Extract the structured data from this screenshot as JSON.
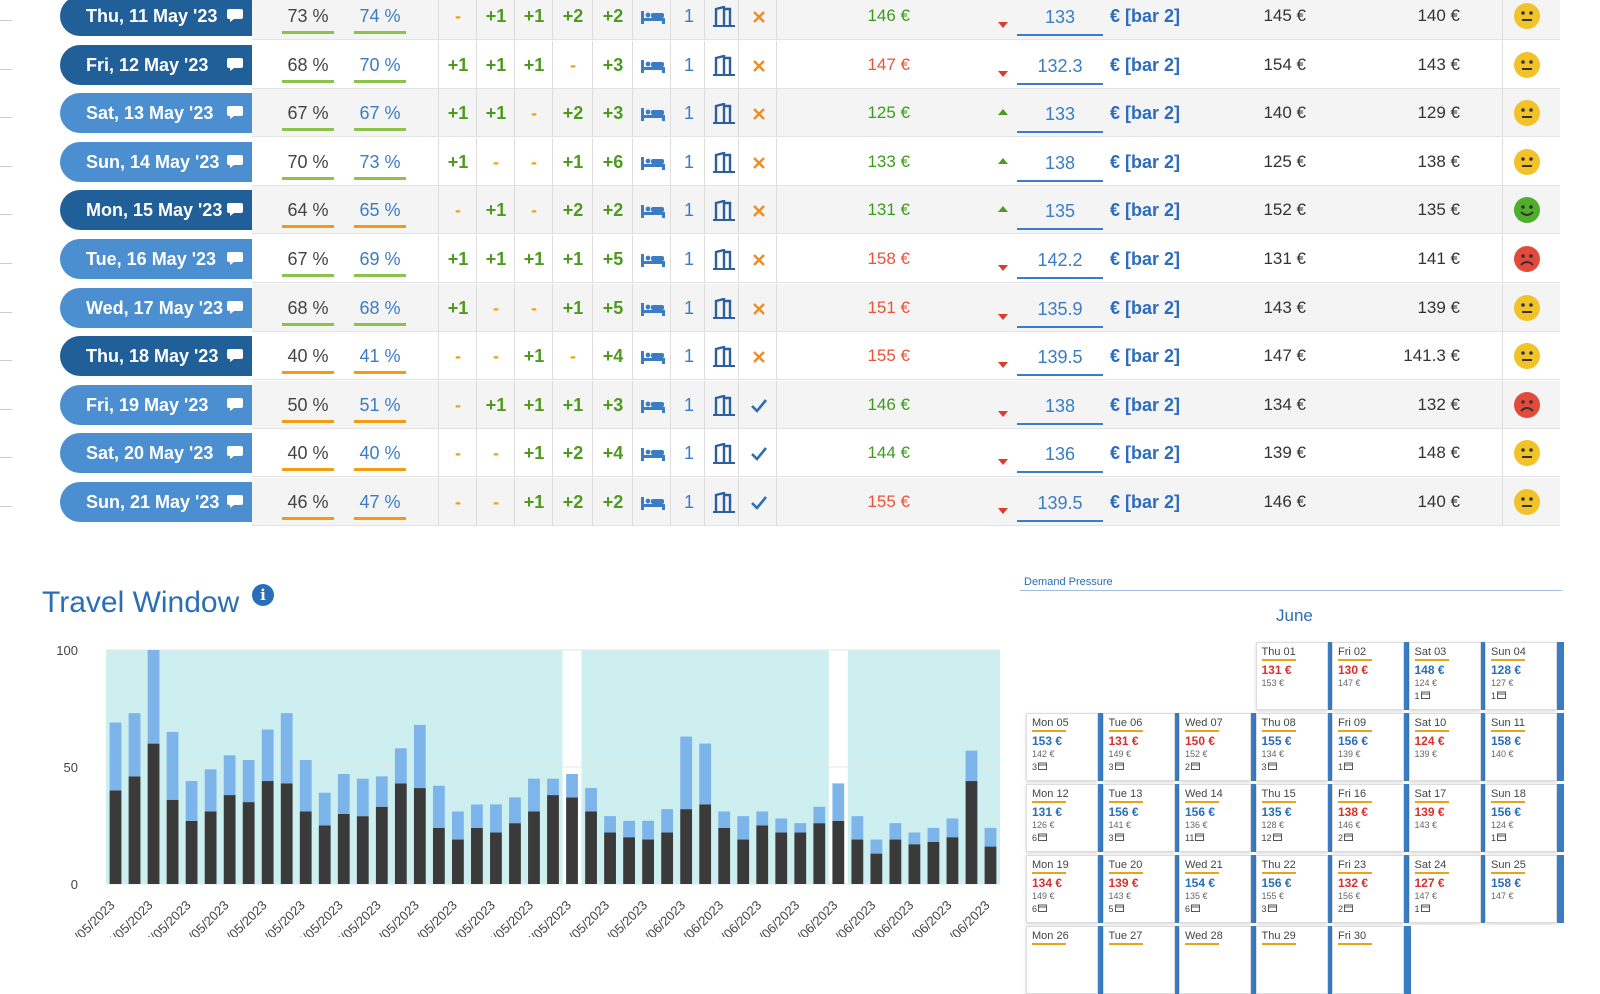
{
  "table": {
    "bar_label": "€ [bar 2]",
    "rows": [
      {
        "date": "Thu, 11 May '23",
        "style": "dark",
        "occ1": "73 %",
        "occ2": "74 %",
        "u1": "#8bc34a",
        "u2": "#8bc34a",
        "p1": "-",
        "p2": "+1",
        "p3": "+1",
        "p4": "+2",
        "p5": "+2",
        "count": "1",
        "status": "x",
        "price": "146 €",
        "price_color": "g",
        "trend": "down",
        "input": "133",
        "c1": "145 €",
        "c2": "140 €",
        "mood": "neutral"
      },
      {
        "date": "Fri, 12 May '23",
        "style": "dark",
        "occ1": "68 %",
        "occ2": "70 %",
        "u1": "#8bc34a",
        "u2": "#8bc34a",
        "p1": "+1",
        "p2": "+1",
        "p3": "+1",
        "p4": "-",
        "p5": "+3",
        "count": "1",
        "status": "x",
        "price": "147 €",
        "price_color": "r",
        "trend": "down",
        "input": "132.3",
        "c1": "154 €",
        "c2": "143 €",
        "mood": "neutral"
      },
      {
        "date": "Sat, 13 May '23",
        "style": "light",
        "occ1": "67 %",
        "occ2": "67 %",
        "u1": "#8bc34a",
        "u2": "#8bc34a",
        "p1": "+1",
        "p2": "+1",
        "p3": "-",
        "p4": "+2",
        "p5": "+3",
        "count": "1",
        "status": "x",
        "price": "125 €",
        "price_color": "g",
        "trend": "up",
        "input": "133",
        "c1": "140 €",
        "c2": "129 €",
        "mood": "neutral"
      },
      {
        "date": "Sun, 14 May '23",
        "style": "light",
        "occ1": "70 %",
        "occ2": "73 %",
        "u1": "#8bc34a",
        "u2": "#8bc34a",
        "p1": "+1",
        "p2": "-",
        "p3": "-",
        "p4": "+1",
        "p5": "+6",
        "count": "1",
        "status": "x",
        "price": "133 €",
        "price_color": "g",
        "trend": "up",
        "input": "138",
        "c1": "125 €",
        "c2": "138 €",
        "mood": "neutral"
      },
      {
        "date": "Mon, 15 May '23",
        "style": "dark",
        "occ1": "64 %",
        "occ2": "65 %",
        "u1": "#f39c12",
        "u2": "#f39c12",
        "p1": "-",
        "p2": "+1",
        "p3": "-",
        "p4": "+2",
        "p5": "+2",
        "count": "1",
        "status": "x",
        "price": "131 €",
        "price_color": "g",
        "trend": "up",
        "input": "135",
        "c1": "152 €",
        "c2": "135 €",
        "mood": "happy"
      },
      {
        "date": "Tue, 16 May '23",
        "style": "light",
        "occ1": "67 %",
        "occ2": "69 %",
        "u1": "#8bc34a",
        "u2": "#8bc34a",
        "p1": "+1",
        "p2": "+1",
        "p3": "+1",
        "p4": "+1",
        "p5": "+5",
        "count": "1",
        "status": "x",
        "price": "158 €",
        "price_color": "r",
        "trend": "down",
        "input": "142.2",
        "c1": "131 €",
        "c2": "141 €",
        "mood": "sad"
      },
      {
        "date": "Wed, 17 May '23",
        "style": "light",
        "occ1": "68 %",
        "occ2": "68 %",
        "u1": "#8bc34a",
        "u2": "#8bc34a",
        "p1": "+1",
        "p2": "-",
        "p3": "-",
        "p4": "+1",
        "p5": "+5",
        "count": "1",
        "status": "x",
        "price": "151 €",
        "price_color": "r",
        "trend": "down",
        "input": "135.9",
        "c1": "143 €",
        "c2": "139 €",
        "mood": "neutral"
      },
      {
        "date": "Thu, 18 May '23",
        "style": "dark",
        "occ1": "40 %",
        "occ2": "41 %",
        "u1": "#f39c12",
        "u2": "#f39c12",
        "p1": "-",
        "p2": "-",
        "p3": "+1",
        "p4": "-",
        "p5": "+4",
        "count": "1",
        "status": "x",
        "price": "155 €",
        "price_color": "r",
        "trend": "down",
        "input": "139.5",
        "c1": "147 €",
        "c2": "141.3 €",
        "mood": "neutral"
      },
      {
        "date": "Fri, 19 May '23",
        "style": "light",
        "occ1": "50 %",
        "occ2": "51 %",
        "u1": "#f39c12",
        "u2": "#f39c12",
        "p1": "-",
        "p2": "+1",
        "p3": "+1",
        "p4": "+1",
        "p5": "+3",
        "count": "1",
        "status": "check",
        "price": "146 €",
        "price_color": "g",
        "trend": "down",
        "input": "138",
        "c1": "134 €",
        "c2": "132 €",
        "mood": "sad"
      },
      {
        "date": "Sat, 20 May '23",
        "style": "light",
        "occ1": "40 %",
        "occ2": "40 %",
        "u1": "#f39c12",
        "u2": "#f39c12",
        "p1": "-",
        "p2": "-",
        "p3": "+1",
        "p4": "+2",
        "p5": "+4",
        "count": "1",
        "status": "check",
        "price": "144 €",
        "price_color": "g",
        "trend": "down",
        "input": "136",
        "c1": "139 €",
        "c2": "148 €",
        "mood": "neutral"
      },
      {
        "date": "Sun, 21 May '23",
        "style": "light",
        "occ1": "46 %",
        "occ2": "47 %",
        "u1": "#f39c12",
        "u2": "#f39c12",
        "p1": "-",
        "p2": "-",
        "p3": "+1",
        "p4": "+2",
        "p5": "+2",
        "count": "1",
        "status": "check",
        "price": "155 €",
        "price_color": "r",
        "trend": "down",
        "input": "139.5",
        "c1": "146 €",
        "c2": "140 €",
        "mood": "neutral"
      }
    ]
  },
  "travel_window": {
    "title": "Travel Window",
    "info_icon": "i"
  },
  "chart_data": {
    "type": "bar",
    "stacked": true,
    "ylim": [
      0,
      100
    ],
    "yticks": [
      0,
      50,
      100
    ],
    "xtick_labels": [
      "03/05/2023",
      "05/05/2023",
      "07/05/2023",
      "09/05/2023",
      "11/05/2023",
      "13/05/2023",
      "15/05/2023",
      "17/05/2023",
      "19/05/2023",
      "21/05/2023",
      "23/05/2023",
      "25/05/2023",
      "27/05/2023",
      "29/05/2023",
      "31/05/2023",
      "02/06/2023",
      "04/06/2023",
      "06/06/2023",
      "08/06/2023",
      "10/06/2023",
      "12/06/2023",
      "14/06/2023",
      "16/06/2023",
      "18/06/2023"
    ],
    "colors": {
      "dark": "#3a3a3a",
      "light": "#7db4ea",
      "bg": "#cdeff0"
    },
    "gaps_after_index": [
      23,
      37
    ],
    "series": [
      {
        "values": [
          40,
          46,
          60,
          36,
          27,
          31,
          38,
          35,
          44,
          43,
          31,
          25,
          30,
          29,
          33,
          43,
          41,
          24,
          19,
          24,
          22,
          26,
          31,
          38,
          37,
          31,
          22,
          20,
          19,
          22,
          32,
          34,
          24,
          19,
          25,
          22,
          22,
          26,
          27,
          19,
          13,
          19,
          17,
          18,
          20,
          44,
          16
        ]
      },
      {
        "values": [
          29,
          27,
          40,
          29,
          17,
          18,
          17,
          18,
          22,
          30,
          22,
          14,
          17,
          16,
          13,
          15,
          27,
          18,
          12,
          10,
          12,
          11,
          14,
          7,
          10,
          10,
          7,
          7,
          8,
          10,
          31,
          26,
          7,
          10,
          6,
          6,
          4,
          7,
          16,
          10,
          6,
          7,
          5,
          6,
          8,
          13,
          8
        ]
      }
    ]
  },
  "demand": {
    "label": "Demand Pressure",
    "month": "June",
    "days": [
      {
        "name": "Thu 01",
        "price": "131 €",
        "color": "red",
        "sub": "153 €",
        "unit": "",
        "col": 3,
        "row": 0
      },
      {
        "name": "Fri 02",
        "price": "130 €",
        "color": "red",
        "sub": "147 €",
        "unit": "",
        "col": 4,
        "row": 0
      },
      {
        "name": "Sat 03",
        "price": "148 €",
        "color": "blue",
        "sub": "124 €",
        "unit": "1",
        "col": 5,
        "row": 0
      },
      {
        "name": "Sun 04",
        "price": "128 €",
        "color": "blue",
        "sub": "127 €",
        "unit": "1",
        "col": 6,
        "row": 0
      },
      {
        "name": "Mon 05",
        "price": "153 €",
        "color": "blue",
        "sub": "142 €",
        "unit": "3",
        "col": 0,
        "row": 1
      },
      {
        "name": "Tue 06",
        "price": "131 €",
        "color": "red",
        "sub": "149 €",
        "unit": "3",
        "col": 1,
        "row": 1
      },
      {
        "name": "Wed 07",
        "price": "150 €",
        "color": "red",
        "sub": "152 €",
        "unit": "2",
        "col": 2,
        "row": 1
      },
      {
        "name": "Thu 08",
        "price": "155 €",
        "color": "blue",
        "sub": "134 €",
        "unit": "3",
        "col": 3,
        "row": 1
      },
      {
        "name": "Fri 09",
        "price": "156 €",
        "color": "blue",
        "sub": "139 €",
        "unit": "1",
        "col": 4,
        "row": 1
      },
      {
        "name": "Sat 10",
        "price": "124 €",
        "color": "red",
        "sub": "139 €",
        "unit": "",
        "col": 5,
        "row": 1
      },
      {
        "name": "Sun 11",
        "price": "158 €",
        "color": "blue",
        "sub": "140 €",
        "unit": "",
        "col": 6,
        "row": 1
      },
      {
        "name": "Mon 12",
        "price": "131 €",
        "color": "blue",
        "sub": "126 €",
        "unit": "6",
        "col": 0,
        "row": 2
      },
      {
        "name": "Tue 13",
        "price": "156 €",
        "color": "blue",
        "sub": "141 €",
        "unit": "3",
        "col": 1,
        "row": 2
      },
      {
        "name": "Wed 14",
        "price": "156 €",
        "color": "blue",
        "sub": "136 €",
        "unit": "11",
        "col": 2,
        "row": 2
      },
      {
        "name": "Thu 15",
        "price": "135 €",
        "color": "blue",
        "sub": "128 €",
        "unit": "12",
        "col": 3,
        "row": 2
      },
      {
        "name": "Fri 16",
        "price": "138 €",
        "color": "red",
        "sub": "146 €",
        "unit": "2",
        "col": 4,
        "row": 2
      },
      {
        "name": "Sat 17",
        "price": "139 €",
        "color": "red",
        "sub": "143 €",
        "unit": "",
        "col": 5,
        "row": 2
      },
      {
        "name": "Sun 18",
        "price": "156 €",
        "color": "blue",
        "sub": "124 €",
        "unit": "1",
        "col": 6,
        "row": 2
      },
      {
        "name": "Mon 19",
        "price": "134 €",
        "color": "red",
        "sub": "149 €",
        "unit": "6",
        "col": 0,
        "row": 3
      },
      {
        "name": "Tue 20",
        "price": "139 €",
        "color": "red",
        "sub": "143 €",
        "unit": "5",
        "col": 1,
        "row": 3
      },
      {
        "name": "Wed 21",
        "price": "154 €",
        "color": "blue",
        "sub": "135 €",
        "unit": "6",
        "col": 2,
        "row": 3
      },
      {
        "name": "Thu 22",
        "price": "156 €",
        "color": "blue",
        "sub": "155 €",
        "unit": "3",
        "col": 3,
        "row": 3
      },
      {
        "name": "Fri 23",
        "price": "132 €",
        "color": "red",
        "sub": "156 €",
        "unit": "2",
        "col": 4,
        "row": 3
      },
      {
        "name": "Sat 24",
        "price": "127 €",
        "color": "red",
        "sub": "147 €",
        "unit": "1",
        "col": 5,
        "row": 3
      },
      {
        "name": "Sun 25",
        "price": "158 €",
        "color": "blue",
        "sub": "147 €",
        "unit": "",
        "col": 6,
        "row": 3
      },
      {
        "name": "Mon 26",
        "price": "",
        "color": "blue",
        "sub": "",
        "unit": "",
        "col": 0,
        "row": 4
      },
      {
        "name": "Tue 27",
        "price": "",
        "color": "blue",
        "sub": "",
        "unit": "",
        "col": 1,
        "row": 4
      },
      {
        "name": "Wed 28",
        "price": "",
        "color": "blue",
        "sub": "",
        "unit": "",
        "col": 2,
        "row": 4
      },
      {
        "name": "Thu 29",
        "price": "",
        "color": "blue",
        "sub": "",
        "unit": "",
        "col": 3,
        "row": 4
      },
      {
        "name": "Fri 30",
        "price": "",
        "color": "blue",
        "sub": "",
        "unit": "",
        "col": 4,
        "row": 4
      }
    ]
  }
}
